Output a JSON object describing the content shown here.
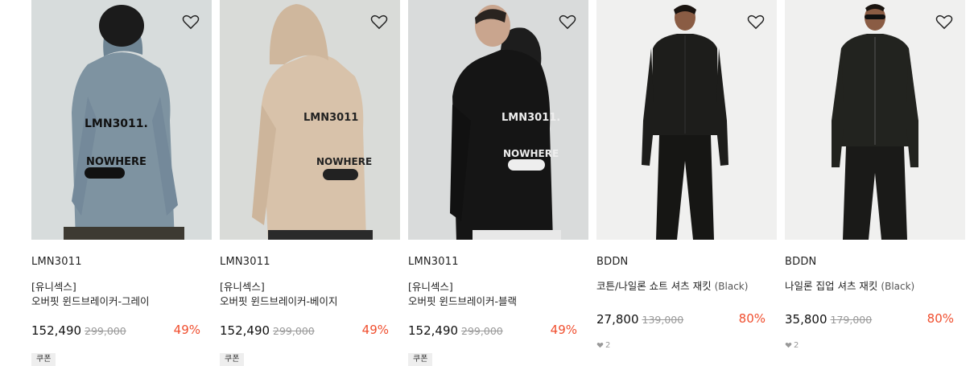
{
  "products": [
    {
      "brand": "LMN3011",
      "name_line1": "[유니섹스]",
      "name_line2": "오버핏 윈드브레이커-그레이",
      "name_suffix": "",
      "price": "152,490",
      "original_price": "299,000",
      "discount": "49%",
      "badge": "쿠폰",
      "likes": "",
      "image_colors": {
        "bg": "#d7dcdc",
        "garment": "#7e93a1"
      }
    },
    {
      "brand": "LMN3011",
      "name_line1": "[유니섹스]",
      "name_line2": "오버핏 윈드브레이커-베이지",
      "name_suffix": "",
      "price": "152,490",
      "original_price": "299,000",
      "discount": "49%",
      "badge": "쿠폰",
      "likes": "",
      "image_colors": {
        "bg": "#d9dbd8",
        "garment": "#d8c2aa"
      }
    },
    {
      "brand": "LMN3011",
      "name_line1": "[유니섹스]",
      "name_line2": "오버핏 윈드브레이커-블랙",
      "name_suffix": "",
      "price": "152,490",
      "original_price": "299,000",
      "discount": "49%",
      "badge": "쿠폰",
      "likes": "",
      "image_colors": {
        "bg": "#d9dbdb",
        "garment": "#151515"
      }
    },
    {
      "brand": "BDDN",
      "name_line1": "",
      "name_line2": "코튼/나일론 쇼트 셔츠 재킷 ",
      "name_suffix": "(Black)",
      "price": "27,800",
      "original_price": "139,000",
      "discount": "80%",
      "badge": "",
      "likes": "2",
      "image_colors": {
        "bg": "#f0f0ef",
        "garment": "#1d1d1b"
      }
    },
    {
      "brand": "BDDN",
      "name_line1": "",
      "name_line2": "나일론 집업 셔츠 재킷 ",
      "name_suffix": "(Black)",
      "price": "35,800",
      "original_price": "179,000",
      "discount": "80%",
      "badge": "",
      "likes": "2",
      "image_colors": {
        "bg": "#f0f0ef",
        "garment": "#22231f"
      }
    }
  ],
  "icons": {
    "wishlist": "heart-outline-icon",
    "like_count": "heart-filled-icon"
  },
  "accent_color": "#f04e2e"
}
